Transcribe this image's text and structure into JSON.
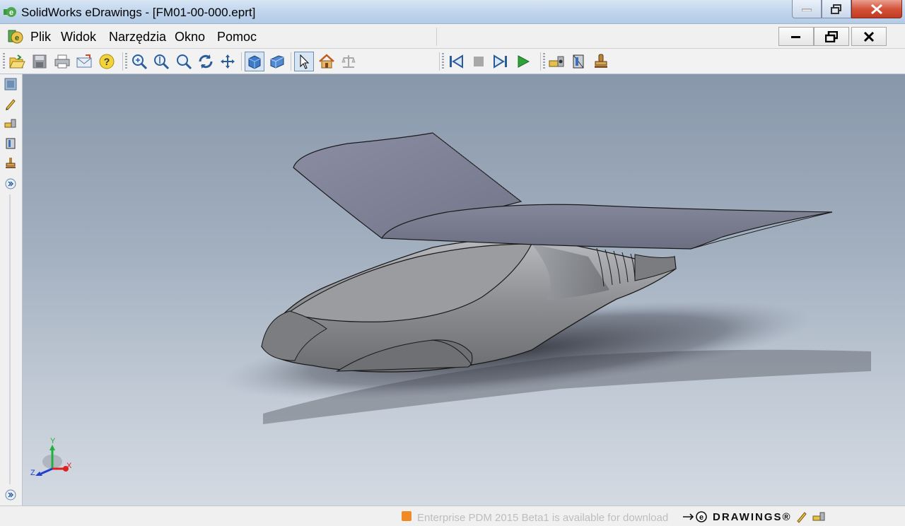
{
  "window": {
    "title": "SolidWorks eDrawings - [FM01-00-000.eprt]"
  },
  "menubar": {
    "items": [
      "Plik",
      "Widok",
      "Narzędzia",
      "Okno",
      "Pomoc"
    ]
  },
  "toolbar": {
    "icons": [
      "open-icon",
      "save-icon",
      "print-icon",
      "send-mail-icon",
      "help-icon",
      "zoom-to-fit-icon",
      "zoom-in-out-icon",
      "zoom-to-area-icon",
      "rotate-icon",
      "pan-icon",
      "shaded-icon",
      "perspective-icon",
      "select-icon",
      "home-icon",
      "mass-properties-icon",
      "first-frame-icon",
      "stop-icon",
      "next-frame-icon",
      "play-icon",
      "measure-icon",
      "section-icon",
      "stamp-icon"
    ]
  },
  "sidebar": {
    "icons": [
      "model-tree-icon",
      "markup-icon",
      "measure-icon",
      "section-icon",
      "stamp-icon",
      "expand-icon",
      "expand-bottom-icon"
    ]
  },
  "triad": {
    "x_label": "X",
    "y_label": "Y",
    "z_label": "Z",
    "x_color": "#e02020",
    "y_color": "#20b040",
    "z_color": "#2040d0"
  },
  "statusbar": {
    "notice": "Enterprise PDM 2015 Beta1 is available for download",
    "logo": "DRAWINGS®"
  },
  "colors": {
    "viewport_top": "#8997ab",
    "viewport_bottom": "#d4dae2",
    "model_body": "#7d7f84",
    "wing": "#7a7e93"
  }
}
